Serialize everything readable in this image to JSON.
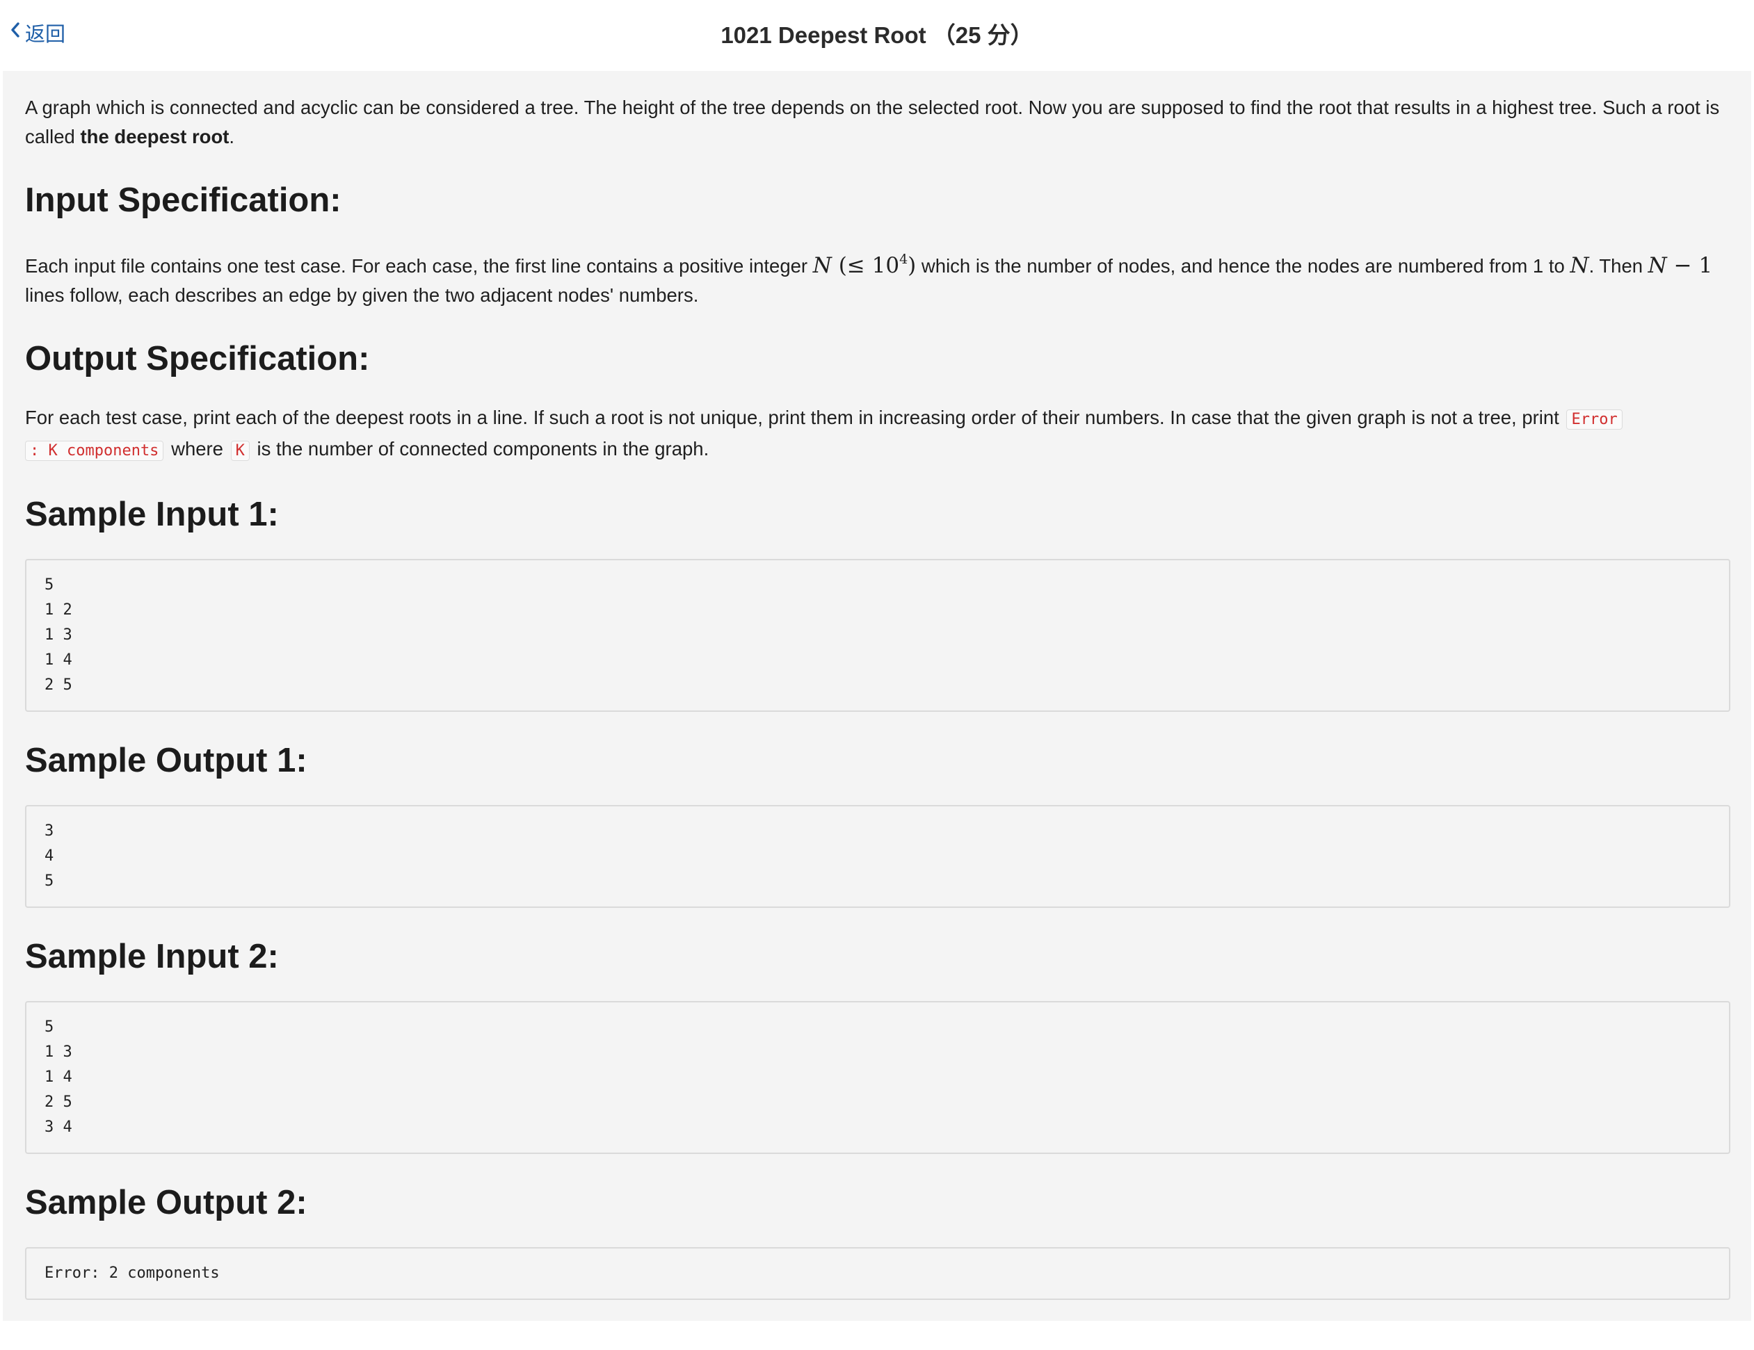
{
  "header": {
    "back_label": "返回",
    "title": "1021 Deepest Root （25 分）"
  },
  "problem": {
    "intro_text": "A graph which is connected and acyclic can be considered a tree. The height of the tree depends on the selected root. Now you are supposed to find the root that results in a highest tree. Such a root is called ",
    "intro_bold": "the deepest root",
    "intro_end": ".",
    "input_heading": "Input Specification:",
    "input_t1": "Each input file contains one test case. For each case, the first line contains a positive integer ",
    "input_t2": " which is the number of nodes, and hence the nodes are numbered from 1 to ",
    "input_t3": ". Then ",
    "input_t4": " lines follow, each describes an edge by given the two adjacent nodes' numbers.",
    "math_N": "N",
    "math_le": "(≤ 10",
    "math_exp": "4",
    "math_close": ")",
    "math_minus": " − 1",
    "output_heading": "Output Specification:",
    "output_t1": "For each test case, print each of the deepest roots in a line. If such a root is not unique, print them in increasing order of their numbers. In case that the given graph is not a tree, print ",
    "output_code1a": "Error",
    "output_code1b": ": K components",
    "output_t2": " where ",
    "output_code2": "K",
    "output_t3": " is the number of connected components in the graph."
  },
  "samples": [
    {
      "heading": "Sample Input 1:",
      "content": "5\n1 2\n1 3\n1 4\n2 5"
    },
    {
      "heading": "Sample Output 1:",
      "content": "3\n4\n5"
    },
    {
      "heading": "Sample Input 2:",
      "content": "5\n1 3\n1 4\n2 5\n3 4"
    },
    {
      "heading": "Sample Output 2:",
      "content": "Error: 2 components"
    }
  ],
  "colors": {
    "link": "#1f5fa8",
    "code_red": "#d12f2f",
    "content_bg": "#f4f4f4"
  },
  "icons": {
    "back": "chevron-left-icon"
  }
}
